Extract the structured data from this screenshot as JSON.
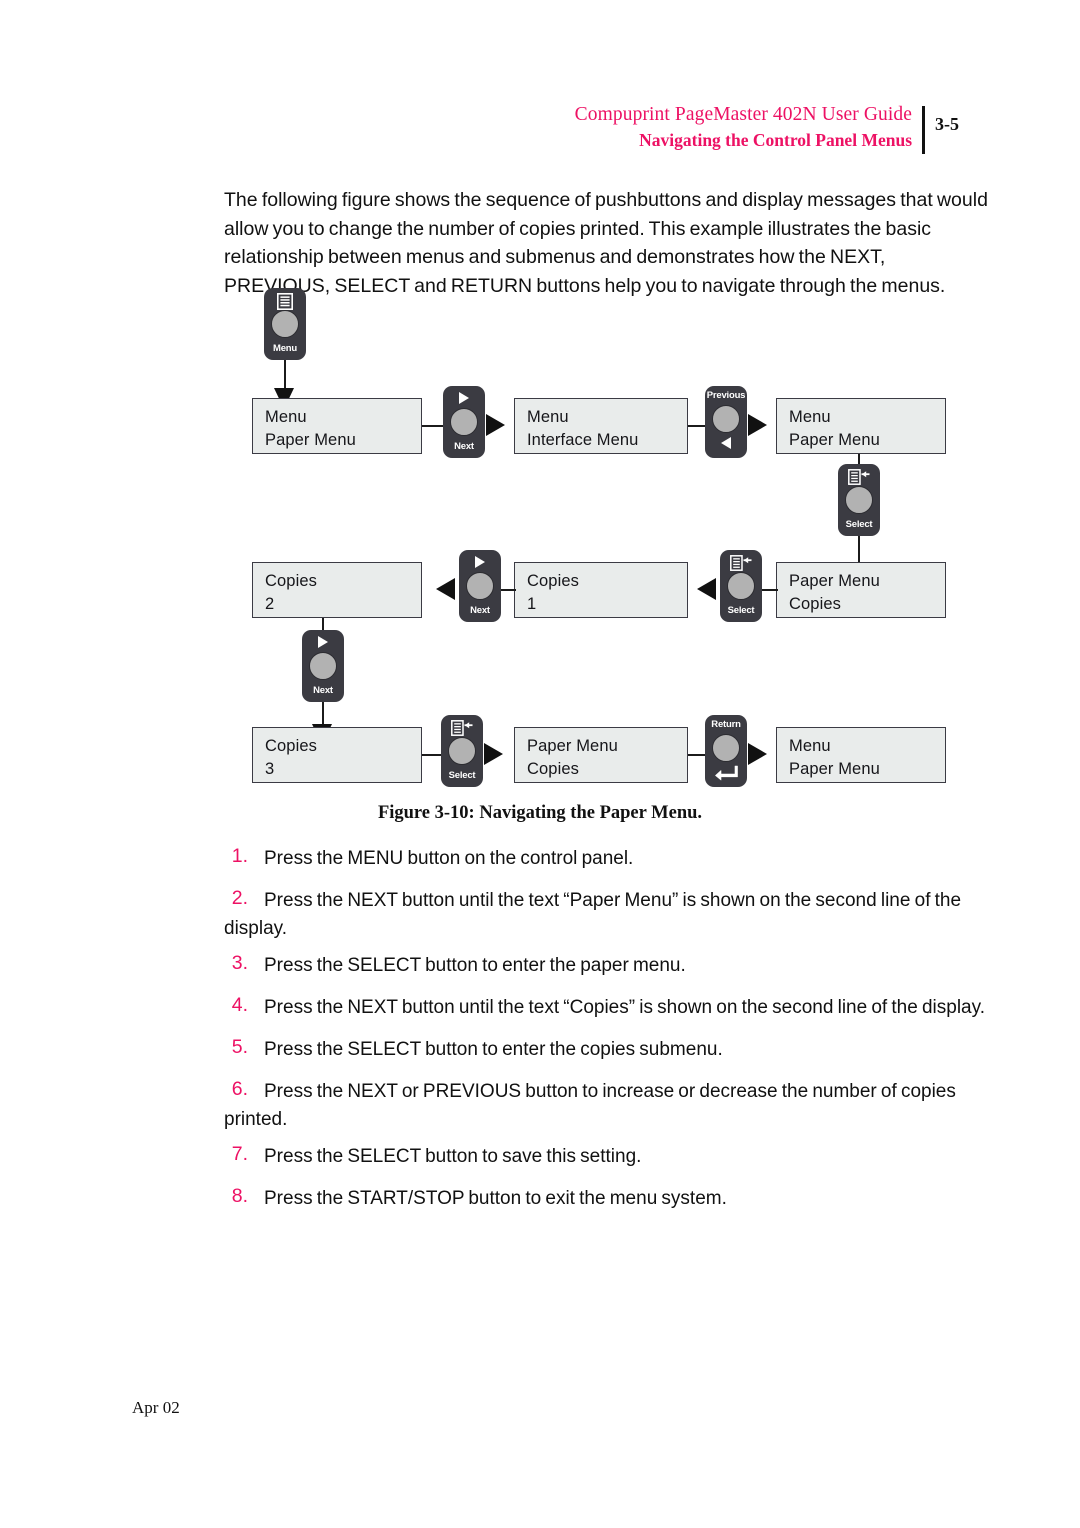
{
  "header": {
    "title": "Compuprint PageMaster 402N User Guide",
    "subtitle": "Navigating the Control Panel Menus",
    "page_number": "3-5",
    "accent_color": "#ed1164"
  },
  "intro": {
    "paragraph": "The following figure shows the sequence of pushbuttons and display messages that would allow you to change the number of copies printed. This example illustrates the basic relationship between menus and submenus and demonstrates how the NEXT, PREVIOUS, SELECT and RETURN buttons help you to navigate through the menus."
  },
  "figure": {
    "caption": "Figure 3-10:  Navigating the Paper Menu.",
    "displays": [
      {
        "id": "d1",
        "line1": "Menu",
        "line2": "Paper Menu"
      },
      {
        "id": "d2",
        "line1": "Menu",
        "line2": "Interface Menu"
      },
      {
        "id": "d3",
        "line1": "Menu",
        "line2": "Paper Menu"
      },
      {
        "id": "d4",
        "line1": "Paper Menu",
        "line2": "Copies"
      },
      {
        "id": "d5",
        "line1": "Copies",
        "line2": "1"
      },
      {
        "id": "d6",
        "line1": "Copies",
        "line2": "2"
      },
      {
        "id": "d7",
        "line1": "Copies",
        "line2": "3"
      },
      {
        "id": "d8",
        "line1": "Paper Menu",
        "line2": "Copies"
      },
      {
        "id": "d9",
        "line1": "Menu",
        "line2": "Paper Menu"
      }
    ],
    "buttons": [
      {
        "id": "b-menu",
        "label": "Menu",
        "icon": "menu-document-icon"
      },
      {
        "id": "b-next-1",
        "label": "Next",
        "icon": "triangle-right-icon"
      },
      {
        "id": "b-previous",
        "label": "Previous",
        "icon": "triangle-left-icon"
      },
      {
        "id": "b-select-1",
        "label": "Select",
        "icon": "select-document-arrow-icon"
      },
      {
        "id": "b-select-2",
        "label": "Select",
        "icon": "select-document-arrow-icon"
      },
      {
        "id": "b-next-2",
        "label": "Next",
        "icon": "triangle-right-icon"
      },
      {
        "id": "b-next-3",
        "label": "Next",
        "icon": "triangle-right-icon"
      },
      {
        "id": "b-select-3",
        "label": "Select",
        "icon": "select-document-arrow-icon"
      },
      {
        "id": "b-return",
        "label": "Return",
        "icon": "return-arrow-icon"
      }
    ]
  },
  "steps": [
    {
      "num": "1.",
      "text": "Press the MENU button on the control panel."
    },
    {
      "num": "2.",
      "text": "Press the NEXT button until the text “Paper Menu” is shown on the second line of the display."
    },
    {
      "num": "3.",
      "text": "Press the SELECT button to enter the paper menu."
    },
    {
      "num": "4.",
      "text": "Press the NEXT button until the text “Copies” is shown on the second line of the display."
    },
    {
      "num": "5.",
      "text": "Press the SELECT button to enter the copies submenu."
    },
    {
      "num": "6.",
      "text": "Press the NEXT or PREVIOUS button to increase or decrease the number of copies printed."
    },
    {
      "num": "7.",
      "text": "Press the SELECT button to save this setting."
    },
    {
      "num": "8.",
      "text": "Press the START/STOP button to exit the menu system."
    }
  ],
  "footer": {
    "date": "Apr 02"
  }
}
